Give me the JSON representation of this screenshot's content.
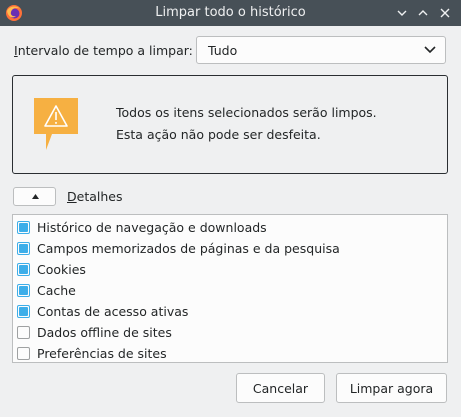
{
  "window": {
    "title": "Limpar todo o histórico",
    "app_icon": "firefox-icon",
    "controls": [
      "chevron-down-icon",
      "chevron-up-icon",
      "close-icon"
    ]
  },
  "time_range": {
    "label_prefix": "I",
    "label_rest": "ntervalo de tempo a limpar:",
    "selected": "Tudo"
  },
  "warning": {
    "icon": "warning-icon",
    "line1": "Todos os itens selecionados serão limpos.",
    "line2": "Esta ação não pode ser desfeita."
  },
  "details": {
    "label_prefix": "D",
    "label_rest": "etalhes",
    "expanded": true
  },
  "items": [
    {
      "label": "Histórico de navegação e downloads",
      "checked": true
    },
    {
      "label": "Campos memorizados de páginas e da pesquisa",
      "checked": true
    },
    {
      "label": "Cookies",
      "checked": true
    },
    {
      "label": "Cache",
      "checked": true
    },
    {
      "label": "Contas de acesso ativas",
      "checked": true
    },
    {
      "label": "Dados offline de sites",
      "checked": false
    },
    {
      "label": "Preferências de sites",
      "checked": false
    }
  ],
  "buttons": {
    "cancel": "Cancelar",
    "clear": "Limpar agora"
  },
  "colors": {
    "titlebar": "#475057",
    "accent": "#3daee9",
    "warning": "#f6b042"
  }
}
